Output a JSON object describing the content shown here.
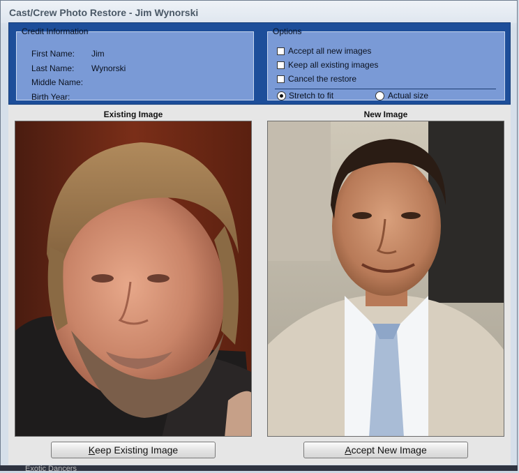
{
  "window": {
    "title": "Cast/Crew Photo Restore - Jim Wynorski"
  },
  "credit": {
    "legend": "Credit Information",
    "fields": [
      {
        "label": "First Name:",
        "value": "Jim"
      },
      {
        "label": "Last Name:",
        "value": "Wynorski"
      },
      {
        "label": "Middle Name:",
        "value": ""
      },
      {
        "label": "Birth Year:",
        "value": ""
      }
    ]
  },
  "options": {
    "legend": "Options",
    "checkboxes": [
      {
        "label": "Accept all new images",
        "checked": false
      },
      {
        "label": "Keep all existing images",
        "checked": false
      },
      {
        "label": "Cancel the restore",
        "checked": false
      }
    ],
    "radios": [
      {
        "label": "Stretch to fit",
        "selected": true
      },
      {
        "label": "Actual size",
        "selected": false
      }
    ]
  },
  "images": {
    "existing_heading": "Existing Image",
    "new_heading": "New Image"
  },
  "buttons": {
    "keep_first": "K",
    "keep_rest": "eep Existing Image",
    "accept_first": "A",
    "accept_rest": "ccept New Image"
  },
  "background": {
    "partial_text": "Exotic Dancers"
  }
}
